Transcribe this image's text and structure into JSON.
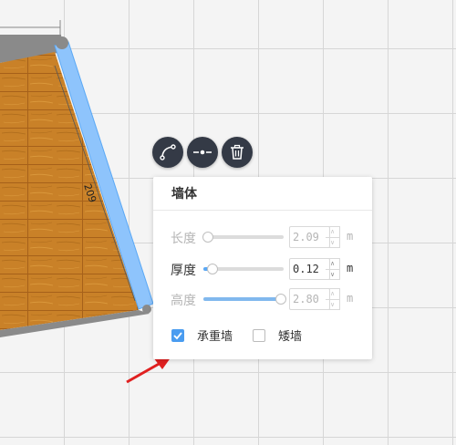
{
  "wall": {
    "dimension_label": "209"
  },
  "toolbar": {
    "buttons": [
      {
        "icon": "curve-wall-icon"
      },
      {
        "icon": "split-wall-icon"
      },
      {
        "icon": "trash-icon"
      }
    ]
  },
  "panel": {
    "title": "墙体",
    "rows": [
      {
        "label": "长度",
        "value": "2.09",
        "unit": "m",
        "enabled": false,
        "level": 0.05
      },
      {
        "label": "厚度",
        "value": "0.12",
        "unit": "m",
        "enabled": true,
        "level": 0.1
      },
      {
        "label": "高度",
        "value": "2.80",
        "unit": "m",
        "enabled": false,
        "level": 0.95
      }
    ],
    "checkboxes": [
      {
        "label": "承重墙",
        "checked": true
      },
      {
        "label": "矮墙",
        "checked": false
      }
    ]
  },
  "colors": {
    "accent": "#4a9cf0",
    "wall_selected": "#8ec4fc",
    "toolbar_bg": "#343a46",
    "annotation_arrow": "#e02020"
  }
}
